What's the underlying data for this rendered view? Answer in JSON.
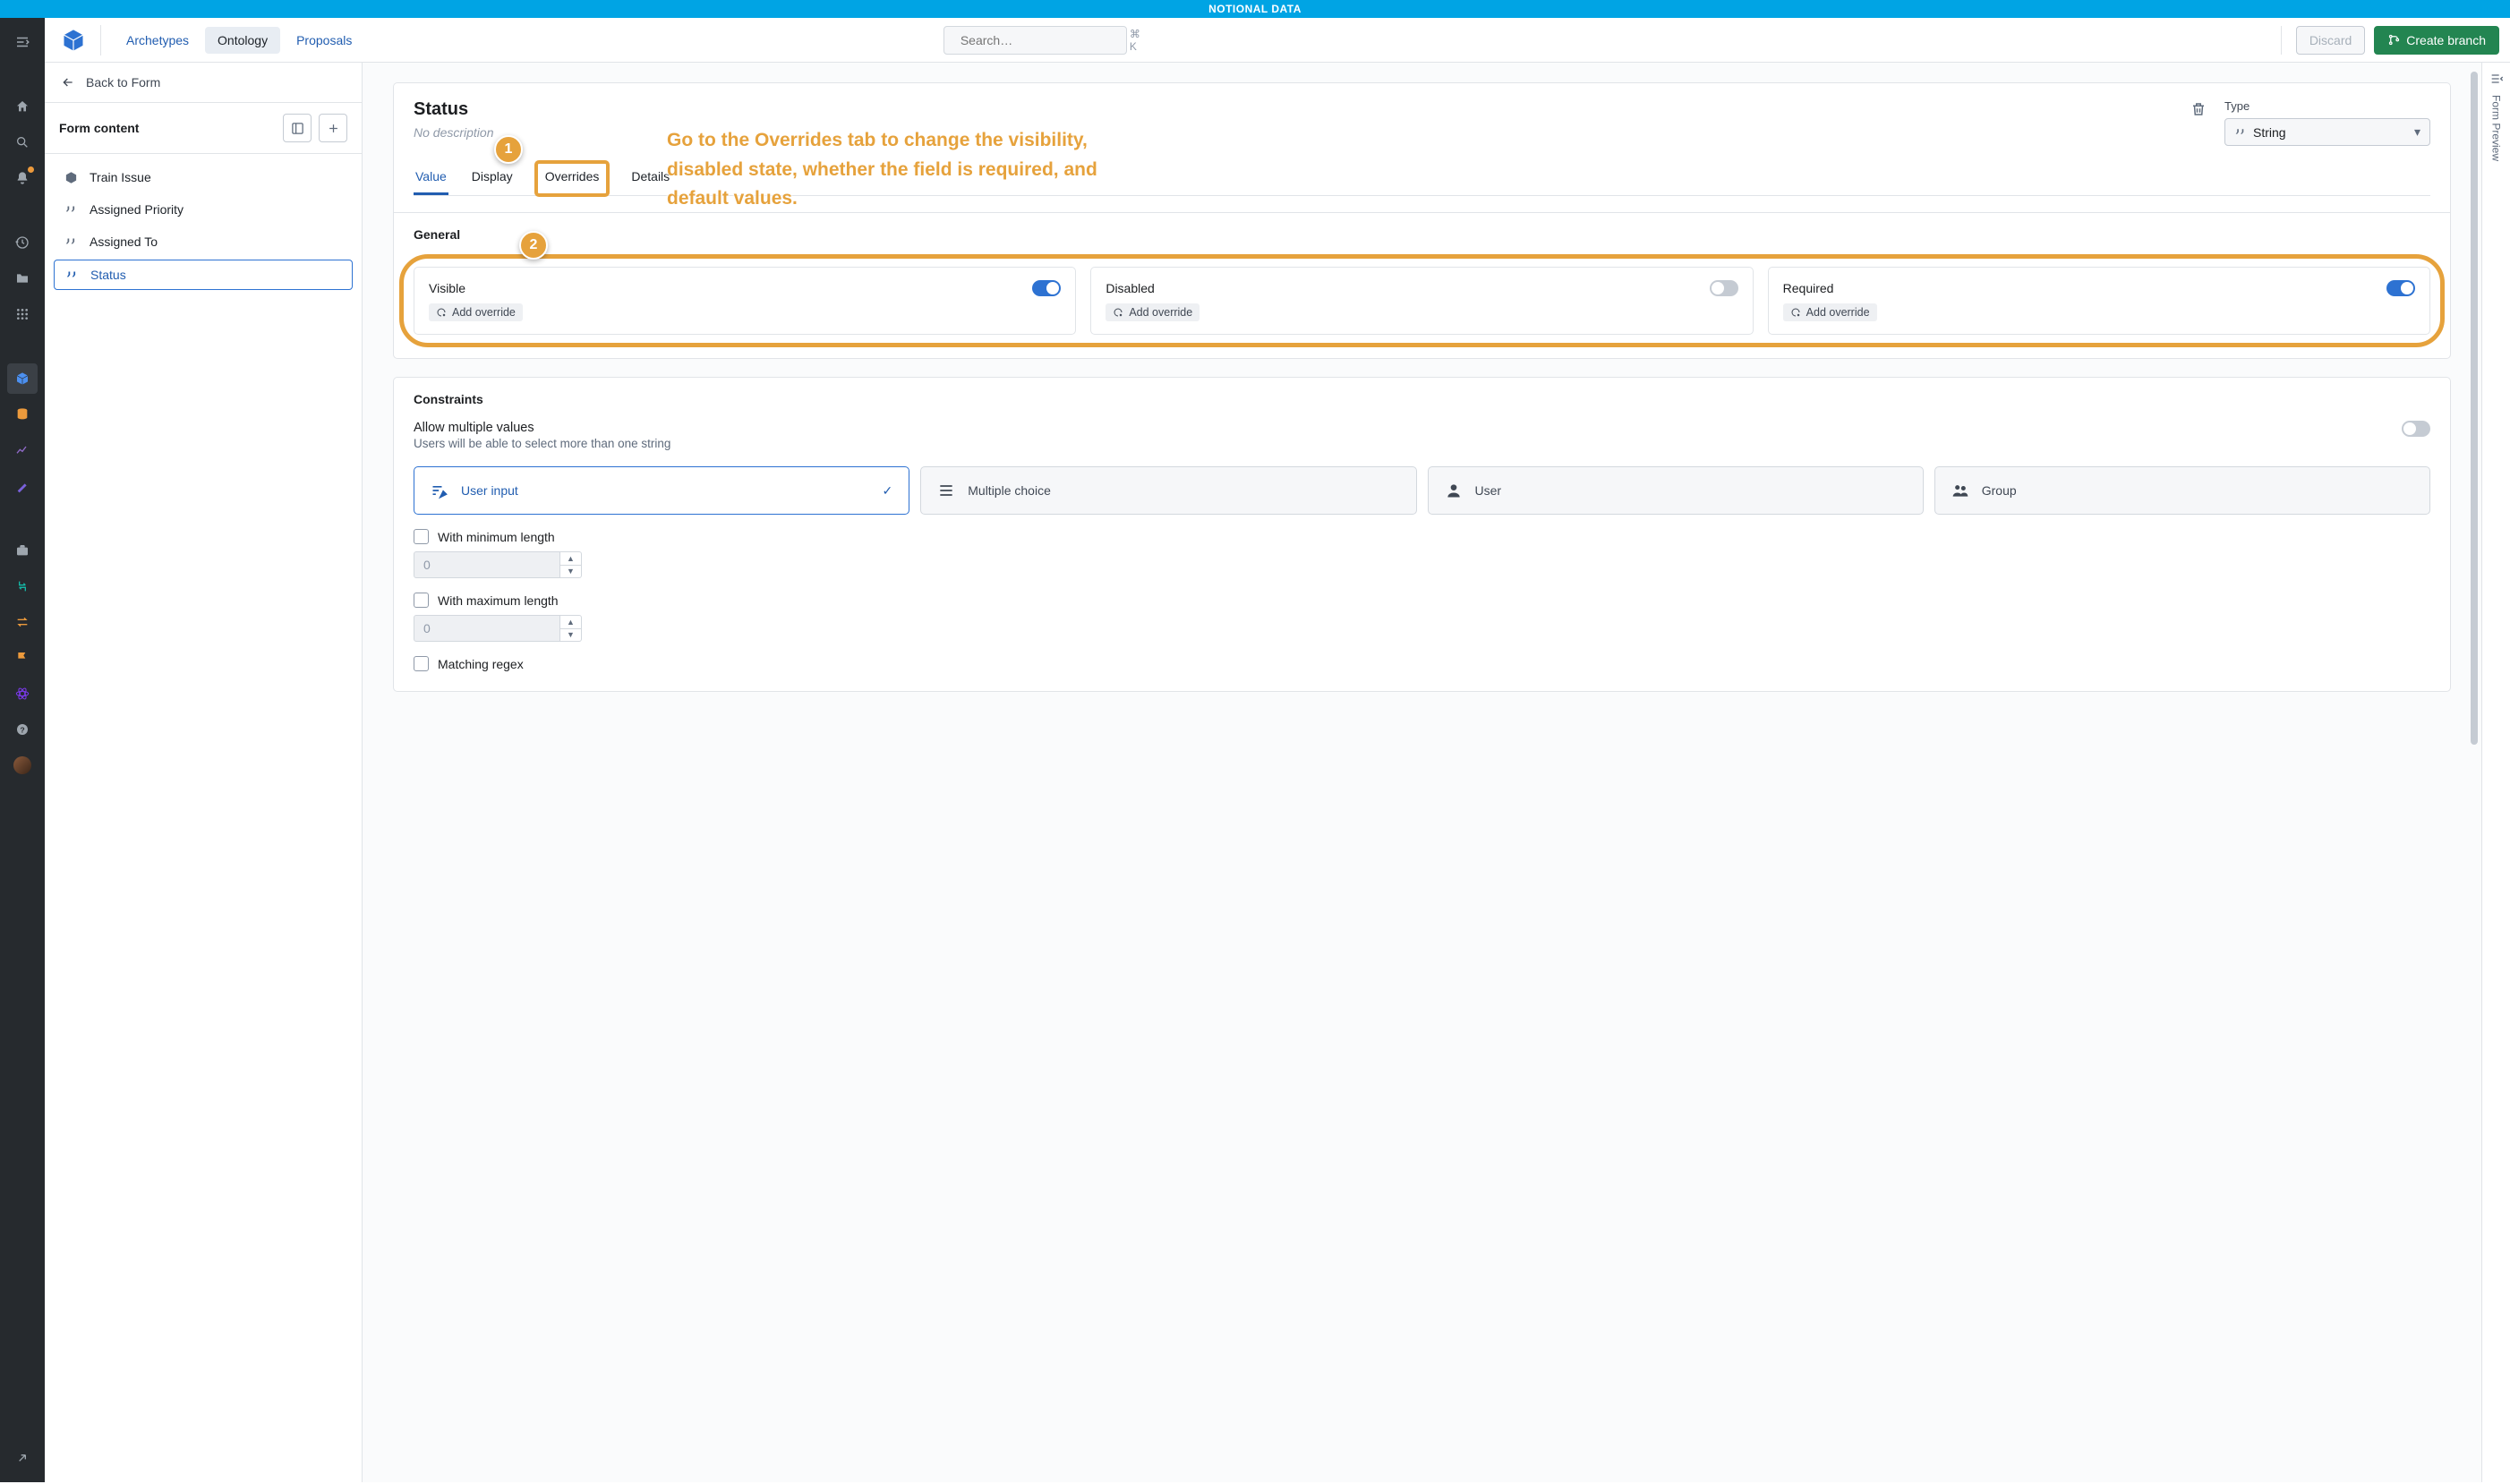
{
  "banner": "NOTIONAL DATA",
  "header": {
    "tabs": {
      "archetypes": "Archetypes",
      "ontology": "Ontology",
      "proposals": "Proposals"
    },
    "search_placeholder": "Search…",
    "search_shortcut": "⌘ K",
    "discard": "Discard",
    "create_branch": "Create branch"
  },
  "side": {
    "back": "Back to Form",
    "formcontent": "Form content",
    "items": [
      {
        "label": "Train Issue",
        "icon": "cube"
      },
      {
        "label": "Assigned Priority",
        "icon": "quote"
      },
      {
        "label": "Assigned To",
        "icon": "quote"
      },
      {
        "label": "Status",
        "icon": "quote",
        "selected": true
      }
    ]
  },
  "main": {
    "title": "Status",
    "nodesc": "No description",
    "type_label": "Type",
    "type_value": "String",
    "tabs": {
      "value": "Value",
      "display": "Display",
      "overrides": "Overrides",
      "details": "Details"
    },
    "general": {
      "title": "General",
      "add_override": "Add override",
      "visible": "Visible",
      "disabled": "Disabled",
      "required": "Required"
    },
    "constraints": {
      "title": "Constraints",
      "allow_t1": "Allow multiple values",
      "allow_t2": "Users will be able to select more than one string",
      "choices": {
        "user_input": "User input",
        "multiple_choice": "Multiple choice",
        "user": "User",
        "group": "Group"
      },
      "with_min": "With minimum length",
      "with_max": "With maximum length",
      "matching_regex": "Matching regex",
      "zero": "0"
    }
  },
  "annotation": {
    "badge1": "1",
    "badge2": "2",
    "text": "Go to the Overrides tab to change the visibility, disabled state, whether the field is required, and default values."
  },
  "right_rail": "Form Preview"
}
